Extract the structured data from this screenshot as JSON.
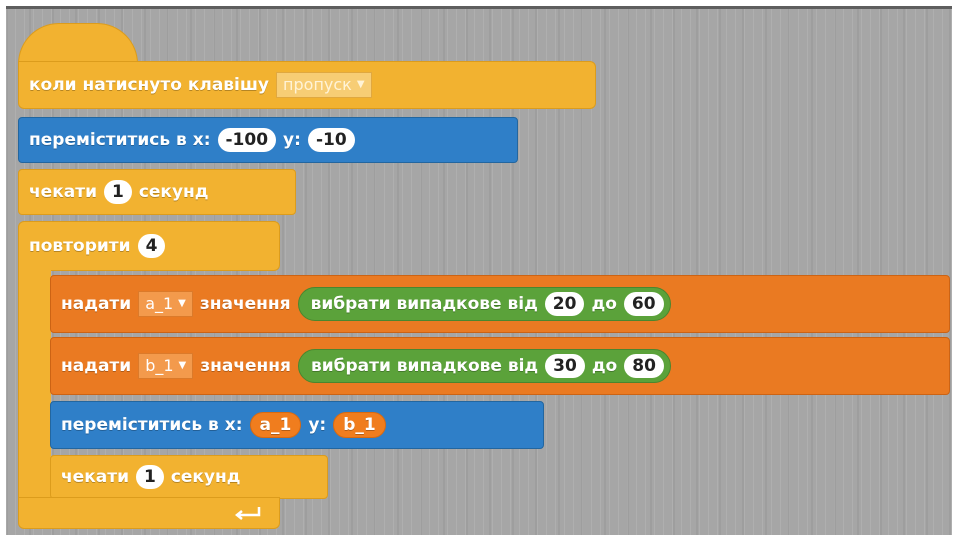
{
  "hat_block": {
    "label": "коли натиснуто клавішу",
    "key": "пропуск"
  },
  "move_block_1": {
    "label": "переміститись в x:",
    "x": "-100",
    "y_label": "y:",
    "y": "-10"
  },
  "wait_block_1": {
    "label": "чекати",
    "value": "1",
    "unit": "секунд"
  },
  "repeat_block": {
    "label": "повторити",
    "count": "4"
  },
  "set_a": {
    "label": "надати",
    "var": "a_1",
    "value_label": "значення",
    "random": {
      "label": "вибрати випадкове від",
      "from": "20",
      "to_label": "до",
      "to": "60"
    }
  },
  "set_b": {
    "label": "надати",
    "var": "b_1",
    "value_label": "значення",
    "random": {
      "label": "вибрати випадкове від",
      "from": "30",
      "to_label": "до",
      "to": "80"
    }
  },
  "move_block_2": {
    "label": "переміститись в x:",
    "x": "a_1",
    "y_label": "y:",
    "y": "b_1"
  },
  "wait_block_2": {
    "label": "чекати",
    "value": "1",
    "unit": "секунд"
  },
  "loop_arrow_icon": "loop-arrow-icon",
  "colors": {
    "control": "#f2b230",
    "motion": "#2f7fc8",
    "data": "#ea7a22",
    "operators": "#5ba23a",
    "canvas": "#a6a6a6"
  }
}
